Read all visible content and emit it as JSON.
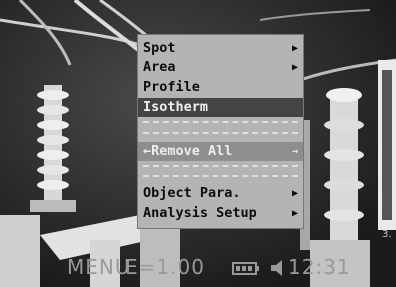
{
  "menu": {
    "items": [
      {
        "label": "Spot",
        "arrow": "▶"
      },
      {
        "label": "Area",
        "arrow": "▶"
      },
      {
        "label": "Profile",
        "arrow": ""
      },
      {
        "label": "Isotherm",
        "arrow": ""
      },
      {
        "label": "←Remove All",
        "arrow": "→"
      },
      {
        "label": "Object Para.",
        "arrow": "▶"
      },
      {
        "label": "Analysis Setup",
        "arrow": "▶"
      }
    ]
  },
  "status": {
    "menu_label": "MENU",
    "emissivity": "E=1.00",
    "time": "12:31",
    "edge_text": "3."
  }
}
